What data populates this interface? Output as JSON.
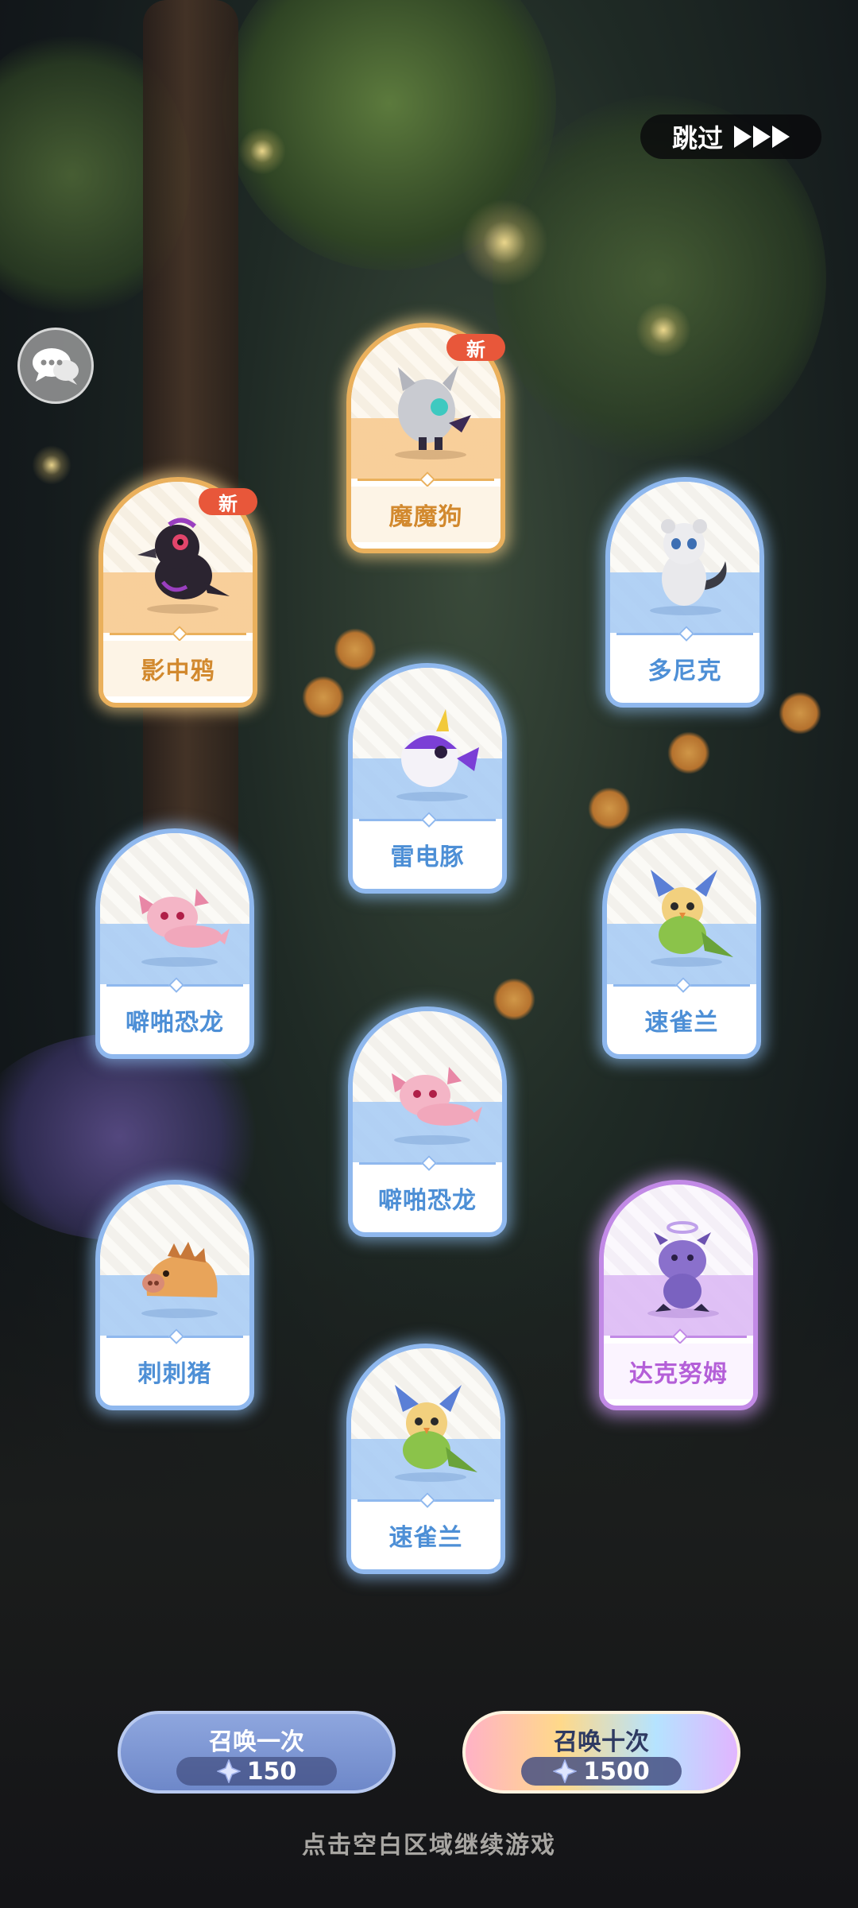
{
  "skip": {
    "label": "跳过"
  },
  "cards": [
    {
      "name": "魔魔狗",
      "rarity": "orange",
      "is_new": true,
      "icon": "shadow-dog-creature-icon"
    },
    {
      "name": "影中鸦",
      "rarity": "orange",
      "is_new": true,
      "icon": "crow-creature-icon"
    },
    {
      "name": "多尼克",
      "rarity": "blue",
      "is_new": false,
      "icon": "white-raccoon-creature-icon"
    },
    {
      "name": "雷电豚",
      "rarity": "blue",
      "is_new": false,
      "icon": "puffer-fish-creature-icon"
    },
    {
      "name": "噼啪恐龙",
      "rarity": "blue",
      "is_new": false,
      "icon": "pink-axolotl-creature-icon"
    },
    {
      "name": "速雀兰",
      "rarity": "blue",
      "is_new": false,
      "icon": "green-bird-creature-icon"
    },
    {
      "name": "噼啪恐龙",
      "rarity": "blue",
      "is_new": false,
      "icon": "pink-axolotl-creature-icon"
    },
    {
      "name": "刺刺猪",
      "rarity": "blue",
      "is_new": false,
      "icon": "boar-creature-icon"
    },
    {
      "name": "达克努姆",
      "rarity": "purple",
      "is_new": false,
      "icon": "purple-imp-creature-icon"
    },
    {
      "name": "速雀兰",
      "rarity": "blue",
      "is_new": false,
      "icon": "green-bird-creature-icon"
    }
  ],
  "new_badge_label": "新",
  "summon_once": {
    "label": "召唤一次",
    "cost": "150"
  },
  "summon_ten": {
    "label": "召唤十次",
    "cost": "1500"
  },
  "hint": "点击空白区域继续游戏",
  "colors": {
    "blue": "#8fb8ee",
    "orange": "#eab05c",
    "purple": "#c28ae6",
    "badge": "#e8573a"
  }
}
